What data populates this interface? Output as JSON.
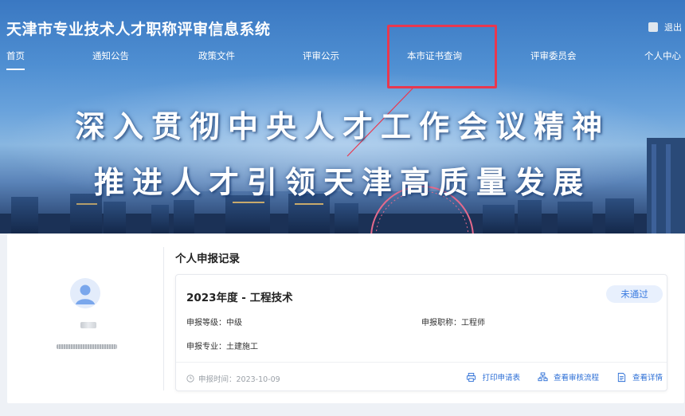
{
  "header": {
    "site_title": "天津市专业技术人才职称评审信息系统",
    "logout_label": "退出"
  },
  "nav": {
    "items": [
      {
        "label": "首页",
        "active": true
      },
      {
        "label": "通知公告"
      },
      {
        "label": "政策文件"
      },
      {
        "label": "评审公示"
      },
      {
        "label": "本市证书查询",
        "highlighted": true
      },
      {
        "label": "评审委员会"
      },
      {
        "label": "个人中心"
      }
    ]
  },
  "banner": {
    "line1": "深入贯彻中央人才工作会议精神",
    "line2": "推进人才引领天津高质量发展"
  },
  "records": {
    "section_title": "个人申报记录",
    "items": [
      {
        "title": "2023年度 - 工程技术",
        "status": "未通过",
        "level": "申报等级：中级",
        "job_title": "申报职称：工程师",
        "major": "申报专业：土建施工",
        "apply_time": "申报时间：2023-10-09",
        "actions": {
          "print": "打印申请表",
          "process": "查看审核流程",
          "detail": "查看详情"
        }
      }
    ]
  },
  "colors": {
    "accent": "#3a7be0",
    "highlight": "#e8384f",
    "status_bg": "#e8f0fd"
  },
  "icons": [
    "user-avatar-icon",
    "clock-icon",
    "printer-icon",
    "flowchart-icon",
    "document-icon"
  ]
}
